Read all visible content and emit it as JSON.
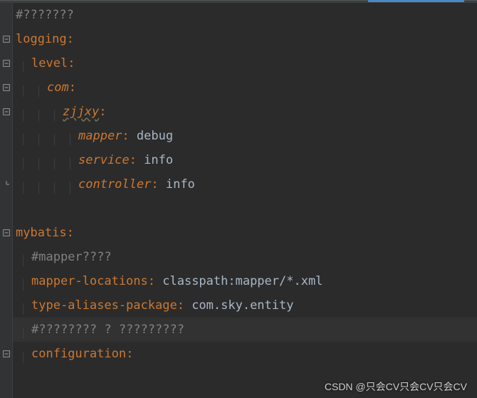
{
  "lines": [
    {
      "indent": 0,
      "spans": [
        {
          "cls": "comment",
          "t": "#???????"
        }
      ],
      "fold": null
    },
    {
      "indent": 0,
      "spans": [
        {
          "cls": "key",
          "t": "logging"
        },
        {
          "cls": "colon",
          "t": ":"
        }
      ],
      "fold": "minus"
    },
    {
      "indent": 1,
      "spans": [
        {
          "cls": "key",
          "t": "level"
        },
        {
          "cls": "colon",
          "t": ":"
        }
      ],
      "fold": "minus"
    },
    {
      "indent": 2,
      "spans": [
        {
          "cls": "key-i",
          "t": "com"
        },
        {
          "cls": "colon",
          "t": ":"
        }
      ],
      "fold": "minus"
    },
    {
      "indent": 3,
      "spans": [
        {
          "cls": "key-u",
          "t": "zjjxy"
        },
        {
          "cls": "colon",
          "t": ":"
        }
      ],
      "fold": "minus"
    },
    {
      "indent": 4,
      "spans": [
        {
          "cls": "key-i",
          "t": "mapper"
        },
        {
          "cls": "colon",
          "t": ": "
        },
        {
          "cls": "val",
          "t": "debug"
        }
      ],
      "fold": null
    },
    {
      "indent": 4,
      "spans": [
        {
          "cls": "key-i",
          "t": "service"
        },
        {
          "cls": "colon",
          "t": ": "
        },
        {
          "cls": "val",
          "t": "info"
        }
      ],
      "fold": null
    },
    {
      "indent": 4,
      "spans": [
        {
          "cls": "key-i",
          "t": "controller"
        },
        {
          "cls": "colon",
          "t": ": "
        },
        {
          "cls": "val",
          "t": "info"
        }
      ],
      "fold": "end"
    },
    {
      "indent": 0,
      "spans": [],
      "fold": null
    },
    {
      "indent": 0,
      "spans": [
        {
          "cls": "key",
          "t": "mybatis"
        },
        {
          "cls": "colon",
          "t": ":"
        }
      ],
      "fold": "minus"
    },
    {
      "indent": 1,
      "spans": [
        {
          "cls": "comment",
          "t": "#mapper????"
        }
      ],
      "fold": null
    },
    {
      "indent": 1,
      "spans": [
        {
          "cls": "key",
          "t": "mapper-locations"
        },
        {
          "cls": "colon",
          "t": ": "
        },
        {
          "cls": "val",
          "t": "classpath:mapper/*.xml"
        }
      ],
      "fold": null
    },
    {
      "indent": 1,
      "spans": [
        {
          "cls": "key",
          "t": "type-aliases-package"
        },
        {
          "cls": "colon",
          "t": ": "
        },
        {
          "cls": "val",
          "t": "com.sky.entity"
        }
      ],
      "fold": null
    },
    {
      "indent": 1,
      "spans": [
        {
          "cls": "comment",
          "t": "#???????? ? ?????????"
        }
      ],
      "fold": null,
      "highlight": true
    },
    {
      "indent": 1,
      "spans": [
        {
          "cls": "key",
          "t": "configuration"
        },
        {
          "cls": "colon",
          "t": ":"
        }
      ],
      "fold": "minus"
    }
  ],
  "watermark": "CSDN @只会CV只会CV只会CV",
  "chart_data": {
    "type": "table",
    "title": "YAML configuration snippet",
    "yaml": {
      "logging": {
        "level": {
          "com": {
            "zjjxy": {
              "mapper": "debug",
              "service": "info",
              "controller": "info"
            }
          }
        }
      },
      "mybatis": {
        "mapper-locations": "classpath:mapper/*.xml",
        "type-aliases-package": "com.sky.entity",
        "configuration": {}
      }
    }
  }
}
